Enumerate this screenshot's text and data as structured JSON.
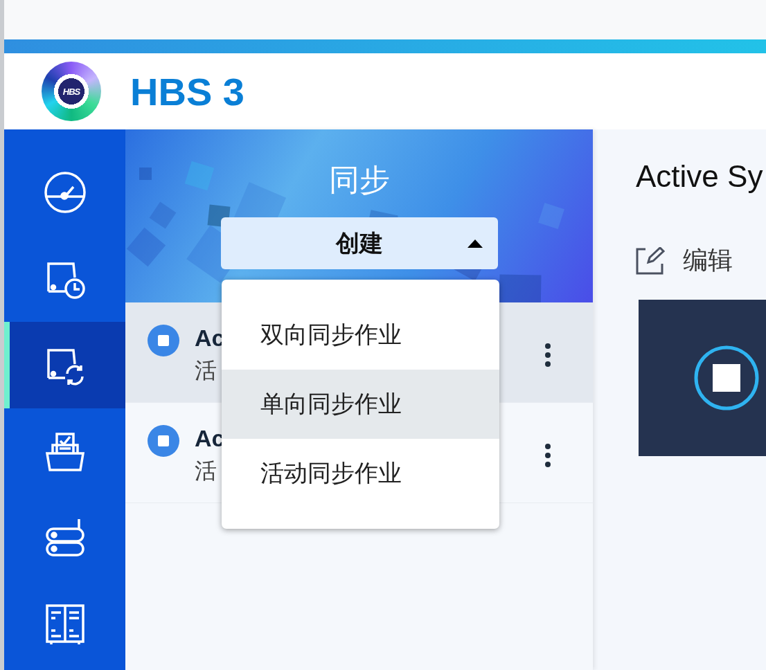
{
  "app": {
    "logo_text": "HBS",
    "title": "HBS 3"
  },
  "nav": [
    {
      "kind": "gauge",
      "selected": false
    },
    {
      "kind": "drive-clock",
      "selected": false
    },
    {
      "kind": "drive-sync",
      "selected": true
    },
    {
      "kind": "tray-check",
      "selected": false
    },
    {
      "kind": "server-stack",
      "selected": false
    },
    {
      "kind": "cabinet",
      "selected": false
    }
  ],
  "panel": {
    "title": "同步",
    "create_button": {
      "label": "创建",
      "expanded": true
    }
  },
  "jobs": [
    {
      "title": "Ac",
      "subtitle": "活",
      "selected": true
    },
    {
      "title": "Ac",
      "subtitle": "活",
      "selected": false
    }
  ],
  "create_menu": [
    {
      "label": "双向同步作业",
      "selected": false
    },
    {
      "label": "单向同步作业",
      "selected": true
    },
    {
      "label": "活动同步作业",
      "selected": false
    }
  ],
  "detail": {
    "title": "Active Sy",
    "edit_label": "编辑"
  }
}
